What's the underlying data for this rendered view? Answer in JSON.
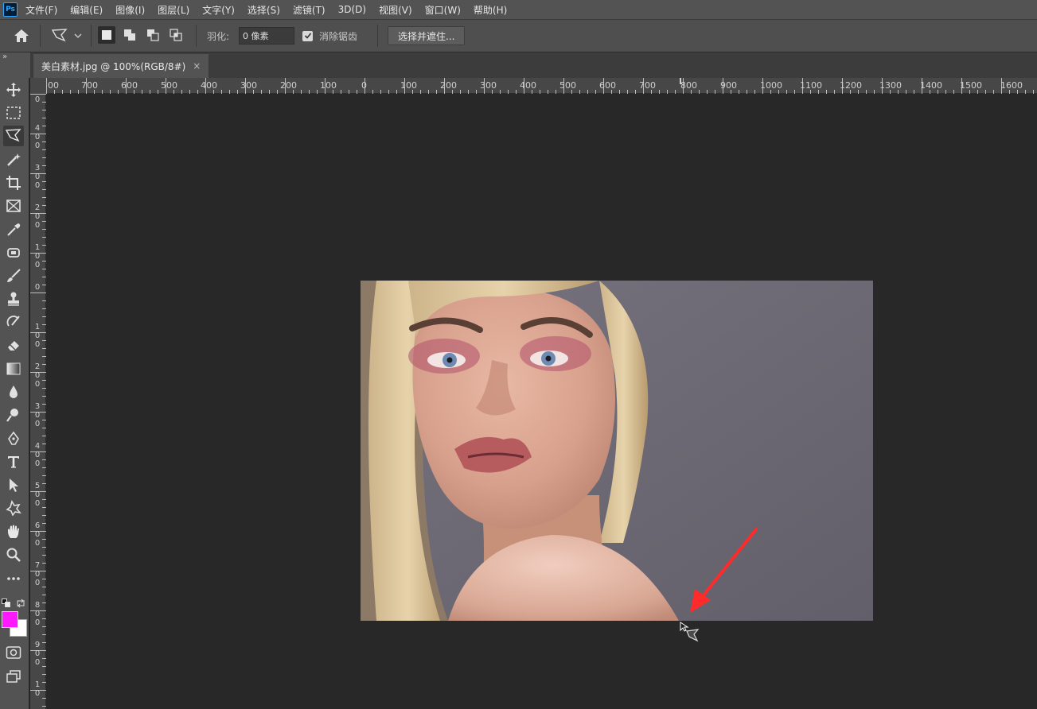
{
  "app": {
    "logo": "Ps"
  },
  "menu": [
    "文件(F)",
    "编辑(E)",
    "图像(I)",
    "图层(L)",
    "文字(Y)",
    "选择(S)",
    "滤镜(T)",
    "3D(D)",
    "视图(V)",
    "窗口(W)",
    "帮助(H)"
  ],
  "options": {
    "feather_label": "羽化:",
    "feather_value": "0 像素",
    "antialias_label": "消除锯齿",
    "antialias_checked": true,
    "select_mask_label": "选择并遮住..."
  },
  "panel": {
    "collapse_label": "»"
  },
  "document": {
    "tab_title": "美白素材.jpg @ 100%(RGB/8#)",
    "close_label": "×"
  },
  "ruler_top_labels": [
    "00",
    "700",
    "600",
    "500",
    "400",
    "300",
    "200",
    "100",
    "0",
    "100",
    "200",
    "300",
    "400",
    "500",
    "600",
    "700",
    "800",
    "900",
    "1000",
    "1100",
    "1200",
    "1300",
    "1400",
    "1500",
    "1600"
  ],
  "ruler_left_labels": [
    "0",
    "4\n0\n0",
    "3\n0\n0",
    "2\n0\n0",
    "1\n0\n0",
    "0",
    "1\n0\n0",
    "2\n0\n0",
    "3\n0\n0",
    "4\n0\n0",
    "5\n0\n0",
    "6\n0\n0",
    "7\n0\n0",
    "8\n0\n0",
    "9\n0\n0",
    "1\n0"
  ],
  "colors": {
    "foreground": "#ff19ff",
    "background": "#ffffff",
    "annotation_arrow": "#ff2a2a",
    "ps_blue": "#31a8ff"
  },
  "tools": [
    "move-icon",
    "marquee-icon",
    "polygon-lasso-icon",
    "magic-wand-icon",
    "crop-icon",
    "frame-icon",
    "eyedropper-icon",
    "healing-icon",
    "brush-icon",
    "stamp-icon",
    "history-brush-icon",
    "eraser-icon",
    "gradient-icon",
    "blur-icon",
    "dodge-icon",
    "pen-icon",
    "type-icon",
    "path-select-icon",
    "shape-icon",
    "hand-icon",
    "zoom-icon",
    "more-icon"
  ]
}
